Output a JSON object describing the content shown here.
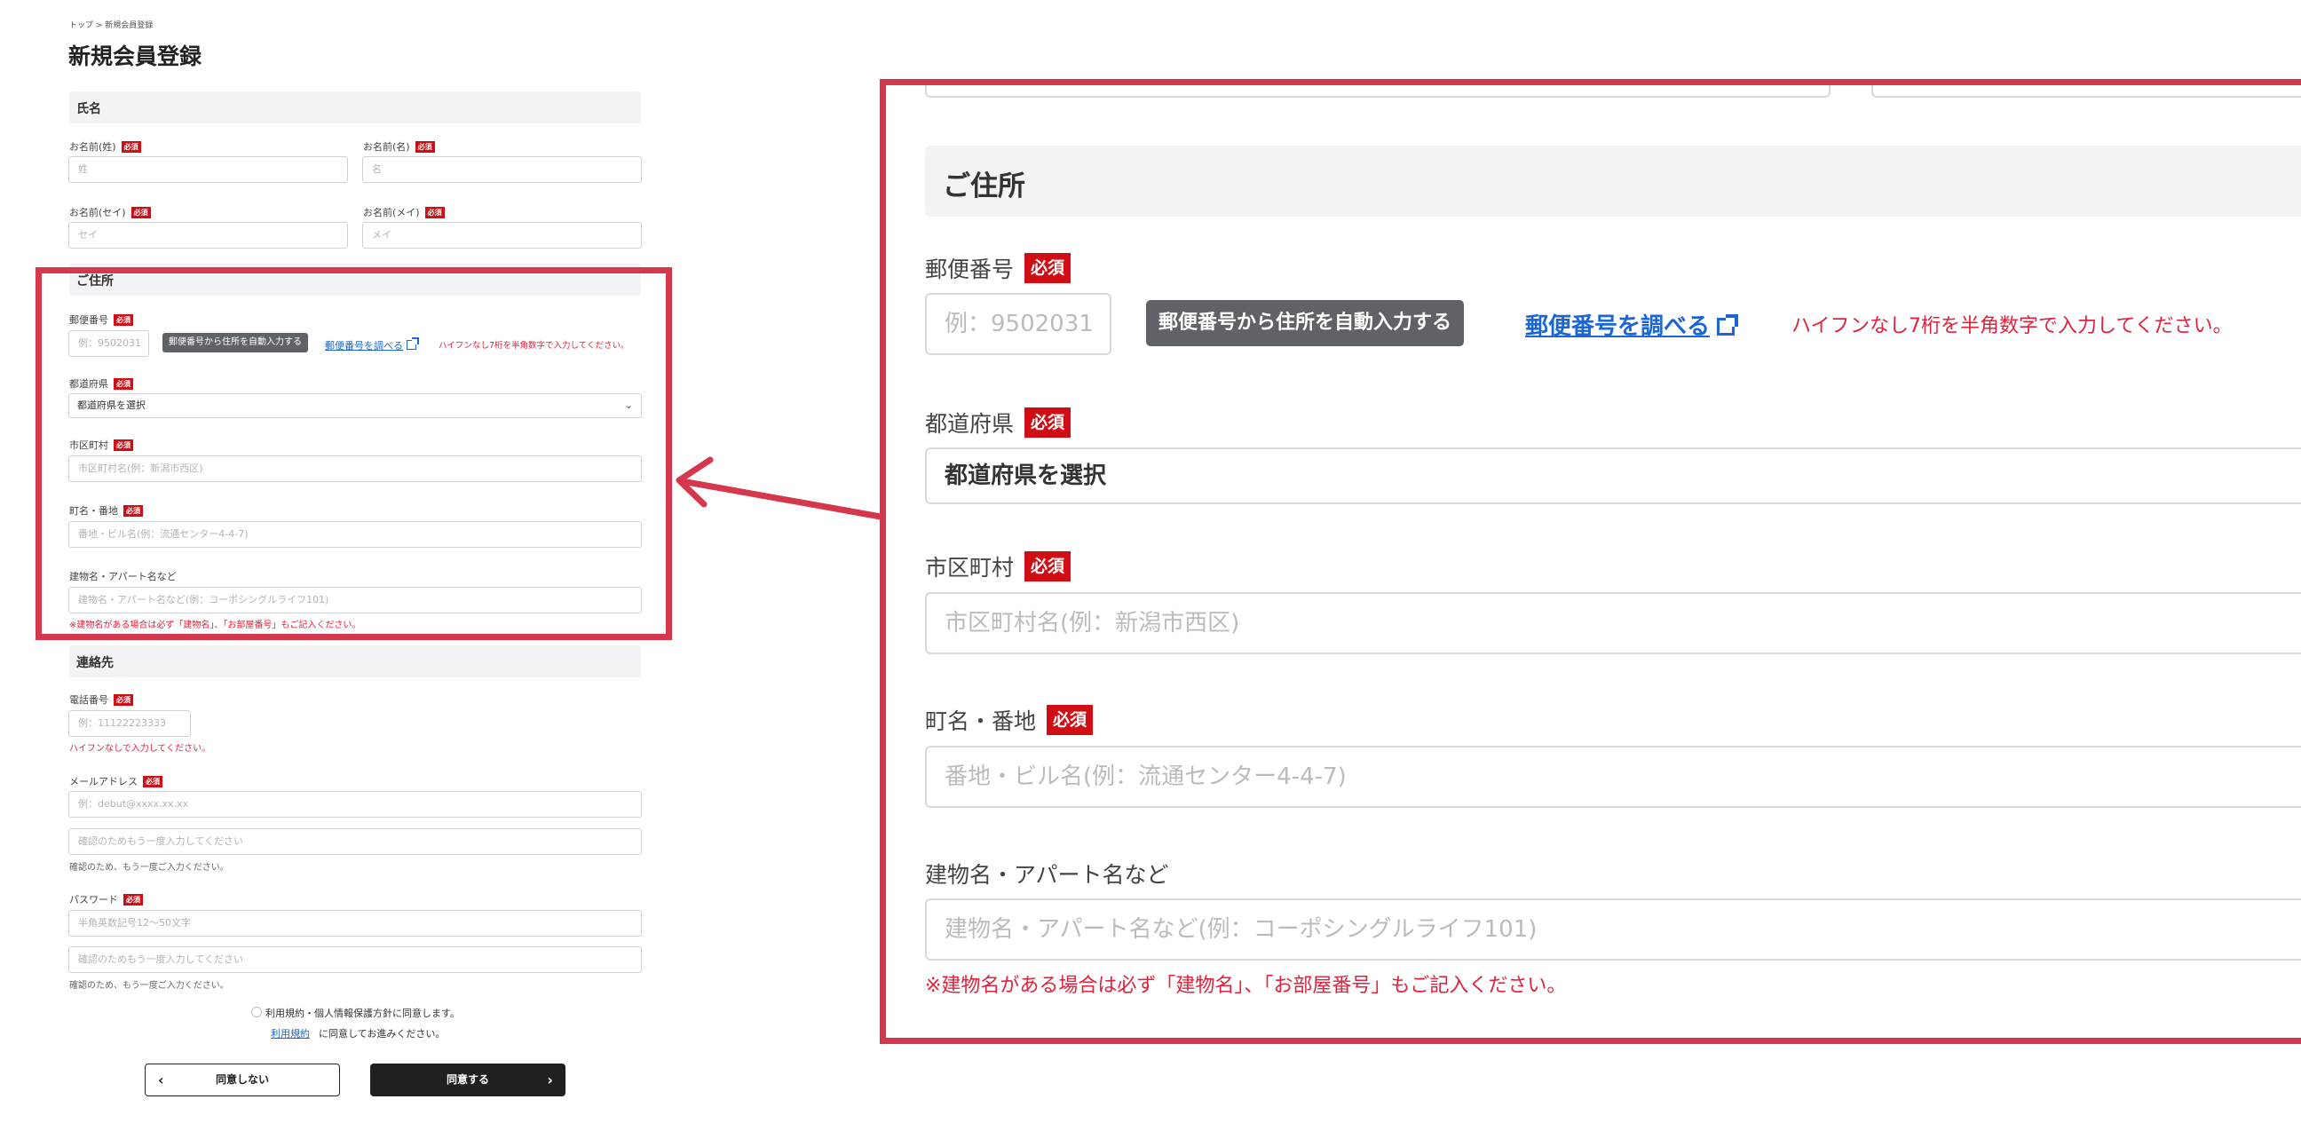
{
  "breadcrumb": "トップ > 新規会員登録",
  "page_title": "新規会員登録",
  "required_badge": "必須",
  "name_section": {
    "title": "氏名",
    "last_name": {
      "label": "お名前(姓)",
      "placeholder": "姓"
    },
    "first_name": {
      "label": "お名前(名)",
      "placeholder": "名"
    },
    "last_name_kana": {
      "label": "お名前(セイ)",
      "placeholder": "セイ"
    },
    "first_name_kana": {
      "label": "お名前(メイ)",
      "placeholder": "メイ"
    }
  },
  "address_section": {
    "title": "ご住所",
    "postal": {
      "label": "郵便番号",
      "placeholder": "例：9502031"
    },
    "autofill_button": "郵便番号から住所を自動入力する",
    "lookup_link": "郵便番号を調べる",
    "postal_hint": "ハイフンなし7桁を半角数字で入力してください。",
    "prefecture": {
      "label": "都道府県",
      "value": "都道府県を選択"
    },
    "city": {
      "label": "市区町村",
      "placeholder": "市区町村名(例：新潟市西区)"
    },
    "street": {
      "label": "町名・番地",
      "placeholder": "番地・ビル名(例：流通センター4-4-7)"
    },
    "building": {
      "label": "建物名・アパート名など",
      "placeholder": "建物名・アパート名など(例：コーポシングルライフ101)"
    },
    "building_note": "※建物名がある場合は必ず「建物名」、「お部屋番号」もご記入ください。"
  },
  "contact_section": {
    "title": "連絡先",
    "phone": {
      "label": "電話番号",
      "placeholder": "例：11122223333",
      "note": "ハイフンなしで入力してください。"
    },
    "email": {
      "label": "メールアドレス",
      "placeholder": "例：debut@xxxx.xx.xx",
      "confirm_placeholder": "確認のためもう一度入力してください",
      "confirm_note": "確認のため、もう一度ご入力ください。"
    },
    "password": {
      "label": "パスワード",
      "placeholder": "半角英数記号12〜50文字",
      "confirm_placeholder": "確認のためもう一度入力してください",
      "confirm_note": "確認のため、もう一度ご入力ください。"
    }
  },
  "agreement": {
    "checkbox_label": "利用規約・個人情報保護方針に同意します。",
    "terms_link": "利用規約",
    "terms_suffix": "に同意してお進みください。"
  },
  "buttons": {
    "disagree": "同意しない",
    "agree": "同意する",
    "disagree_arrow": "‹",
    "agree_arrow": "›"
  },
  "colors": {
    "required": "#d00d15",
    "highlight": "#d5384c",
    "link": "#1a66d6",
    "error_text": "#e1223c",
    "dark_button": "#1e2024"
  }
}
